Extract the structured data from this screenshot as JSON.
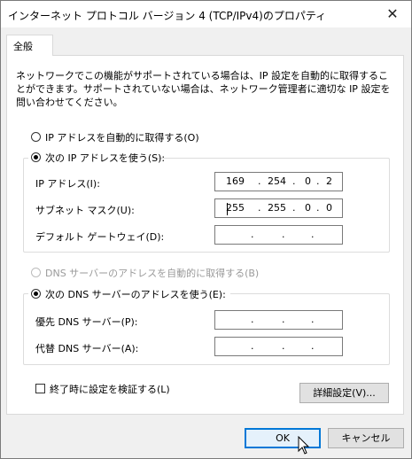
{
  "window": {
    "title": "インターネット プロトコル バージョン 4 (TCP/IPv4)のプロパティ",
    "close_icon": "✕"
  },
  "tabs": [
    {
      "label": "全般"
    }
  ],
  "description": "ネットワークでこの機能がサポートされている場合は、IP 設定を自動的に取得することができます。サポートされていない場合は、ネットワーク管理者に適切な IP 設定を問い合わせてください。",
  "ip_settings": {
    "auto_label": "IP アドレスを自動的に取得する(O)",
    "manual_label": "次の IP アドレスを使う(S):",
    "ip_address": {
      "label": "IP アドレス(I):",
      "octets": [
        "169",
        "254",
        "0",
        "2"
      ]
    },
    "subnet_mask": {
      "label": "サブネット マスク(U):",
      "octets": [
        "255",
        "255",
        "0",
        "0"
      ]
    },
    "default_gateway": {
      "label": "デフォルト ゲートウェイ(D):",
      "octets": [
        "",
        "",
        "",
        ""
      ]
    }
  },
  "dns_settings": {
    "auto_label": "DNS サーバーのアドレスを自動的に取得する(B)",
    "manual_label": "次の DNS サーバーのアドレスを使う(E):",
    "preferred": {
      "label": "優先 DNS サーバー(P):",
      "octets": [
        "",
        "",
        "",
        ""
      ]
    },
    "alternate": {
      "label": "代替 DNS サーバー(A):",
      "octets": [
        "",
        "",
        "",
        ""
      ]
    }
  },
  "validate_label": "終了時に設定を検証する(L)",
  "advanced_button": "詳細設定(V)...",
  "ok_button": "OK",
  "cancel_button": "キャンセル",
  "colors": {
    "accent": "#0078d7",
    "panel": "#ffffff",
    "window": "#f0f0f0"
  }
}
